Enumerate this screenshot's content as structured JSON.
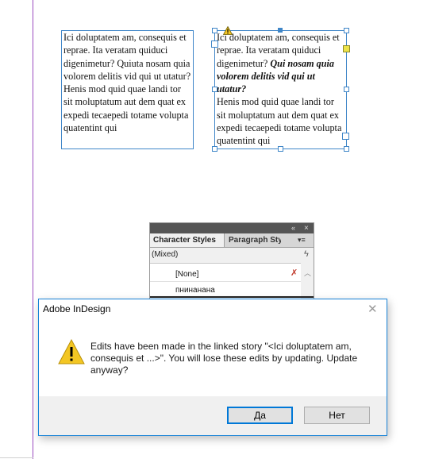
{
  "document": {
    "frame_left": {
      "paragraphs": [
        "Ici doluptatem am, consequis et reprae. Ita veratam quiduci digenimetur? Quiuta nosam quia volorem delitis vid qui ut utatur?",
        "Henis mod quid quae landi tor sit moluptatum aut dem quat ex expedi tecaepedi totame volupta quatentint qui"
      ]
    },
    "frame_right": {
      "para1_plain": "Ici doluptatem am, consequis et reprae. Ita veratam quiduci digenimetur? ",
      "para1_emph": "Qui nosam quia volorem delitis vid qui ut utatur?",
      "para2": "Henis mod quid quae landi tor sit moluptatum aut dem quat ex expedi tecaepedi totame volupta quatentint qui"
    }
  },
  "character_styles_panel": {
    "tabs": [
      {
        "label": "Character Styles",
        "active": true
      },
      {
        "label": "Paragraph Sty",
        "active": false
      }
    ],
    "current_style": "(Mixed)",
    "styles": [
      "[None]",
      "пнинанана"
    ],
    "icons": {
      "collapse": "«",
      "close": "×",
      "menu": "▾≡",
      "lightning": "ϟ",
      "scroll_up": "︿",
      "no_delete": "✗"
    }
  },
  "dialog": {
    "title": "Adobe InDesign",
    "close_glyph": "✕",
    "message": "Edits have been made in the linked story \"<Ici doluptatem am, consequis et ...>\". You will lose these edits by updating. Update anyway?",
    "buttons": {
      "yes": "Да",
      "no": "Нет"
    },
    "icon": "warning-icon"
  },
  "colors": {
    "frame_border": "#3f86c8",
    "page_guide": "#9b4cc0",
    "dialog_border": "#1883d7",
    "warning_yellow": "#f3c623"
  }
}
